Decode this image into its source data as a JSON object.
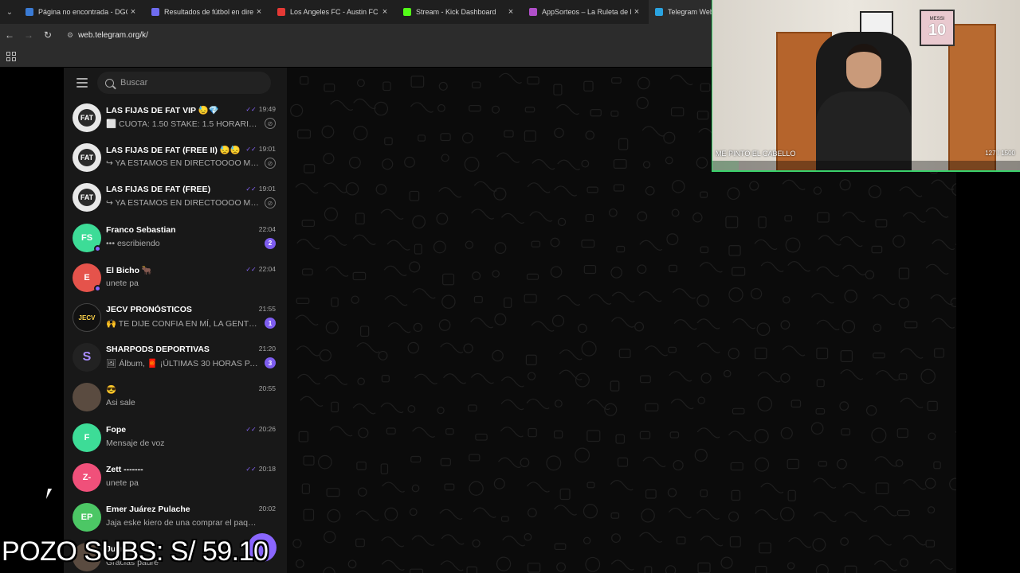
{
  "browser": {
    "tabs": [
      {
        "title": "Página no encontrada - DGO",
        "favicon_color": "#3a7bd5",
        "active": false
      },
      {
        "title": "Resultados de fútbol en directo",
        "favicon_color": "#6f6cf0",
        "active": false
      },
      {
        "title": "Los Angeles FC - Austin FC Cua",
        "favicon_color": "#e53935",
        "active": false
      },
      {
        "title": "Stream - Kick Dashboard",
        "favicon_color": "#53fc18",
        "active": false
      },
      {
        "title": "AppSorteos – La Ruleta de la Su",
        "favicon_color": "#b04fc9",
        "active": false
      },
      {
        "title": "Telegram Web",
        "favicon_color": "#2aa3e0",
        "active": true
      }
    ],
    "address": "web.telegram.org/k/"
  },
  "telegram": {
    "search_placeholder": "Buscar",
    "accent": "#8a66ff",
    "chats": [
      {
        "name": "LAS FIJAS DE FAT VIP 😓💎",
        "preview": "⬜ CUOTA: 1.50 STAKE: 1.5 HORARIO: ...",
        "time": "19:49",
        "read": true,
        "pinned": true,
        "avatar": "FAT",
        "avatar_style": "fat"
      },
      {
        "name": "LAS FIJAS DE FAT (FREE II) 😓😓",
        "preview": "↪ YA ESTAMOS EN DIRECTOOOO MI G...",
        "time": "19:01",
        "read": true,
        "pinned": true,
        "avatar": "FAT",
        "avatar_style": "fat"
      },
      {
        "name": "LAS FIJAS DE FAT (FREE)",
        "preview": "↪ YA ESTAMOS EN DIRECTOOOO MI G...",
        "time": "19:01",
        "read": true,
        "pinned": true,
        "avatar": "FAT",
        "avatar_style": "fat"
      },
      {
        "name": "Franco Sebastian",
        "preview": "••• escribiendo",
        "time": "22:04",
        "badge": "2",
        "avatar": "FS",
        "avatar_color": "#3ddc97",
        "online": true
      },
      {
        "name": "El Bicho 🐂",
        "preview": "unete pa",
        "time": "22:04",
        "read": true,
        "avatar": "E",
        "avatar_color": "#e5534b",
        "online": true
      },
      {
        "name": "JECV PRONÓSTICOS",
        "preview": "🙌 TE DIJE CONFIA EN MÍ, LA GENTE ...",
        "time": "21:55",
        "badge": "1",
        "avatar": "JECV",
        "avatar_style": "jecv"
      },
      {
        "name": "SHARPODS DEPORTIVAS",
        "preview": "🖼 Álbum, 🧧 ¡ÚLTIMAS 30 HORAS PA...",
        "time": "21:20",
        "badge": "3",
        "avatar": "S",
        "avatar_style": "sharp"
      },
      {
        "name": "😎",
        "preview": "Asi sale",
        "time": "20:55",
        "avatar": "",
        "avatar_style": "photo"
      },
      {
        "name": "Fope",
        "preview": "Mensaje de voz",
        "time": "20:26",
        "read": true,
        "avatar": "F",
        "avatar_color": "#3ddc97"
      },
      {
        "name": "Zett -------",
        "preview": "unete pa",
        "time": "20:18",
        "read": true,
        "avatar": "Z-",
        "avatar_color": "#f0507a"
      },
      {
        "name": "Emer Juárez Pulache",
        "preview": "Jaja eske kiero de una comprar el paquete ...",
        "time": "20:02",
        "avatar": "EP",
        "avatar_color": "#4cc765"
      },
      {
        "name": "Juan",
        "preview": "Gracias padre",
        "time": "",
        "avatar": "",
        "avatar_style": "photo"
      }
    ]
  },
  "webcam": {
    "caption": "ME PINTO EL CABELLO",
    "stat": "127 / 1500",
    "progress": 0.085,
    "jersey_name": "MESSI",
    "jersey_number": "10"
  },
  "overlay": {
    "pozo_text": "POZO SUBS: S/ 59.10"
  }
}
